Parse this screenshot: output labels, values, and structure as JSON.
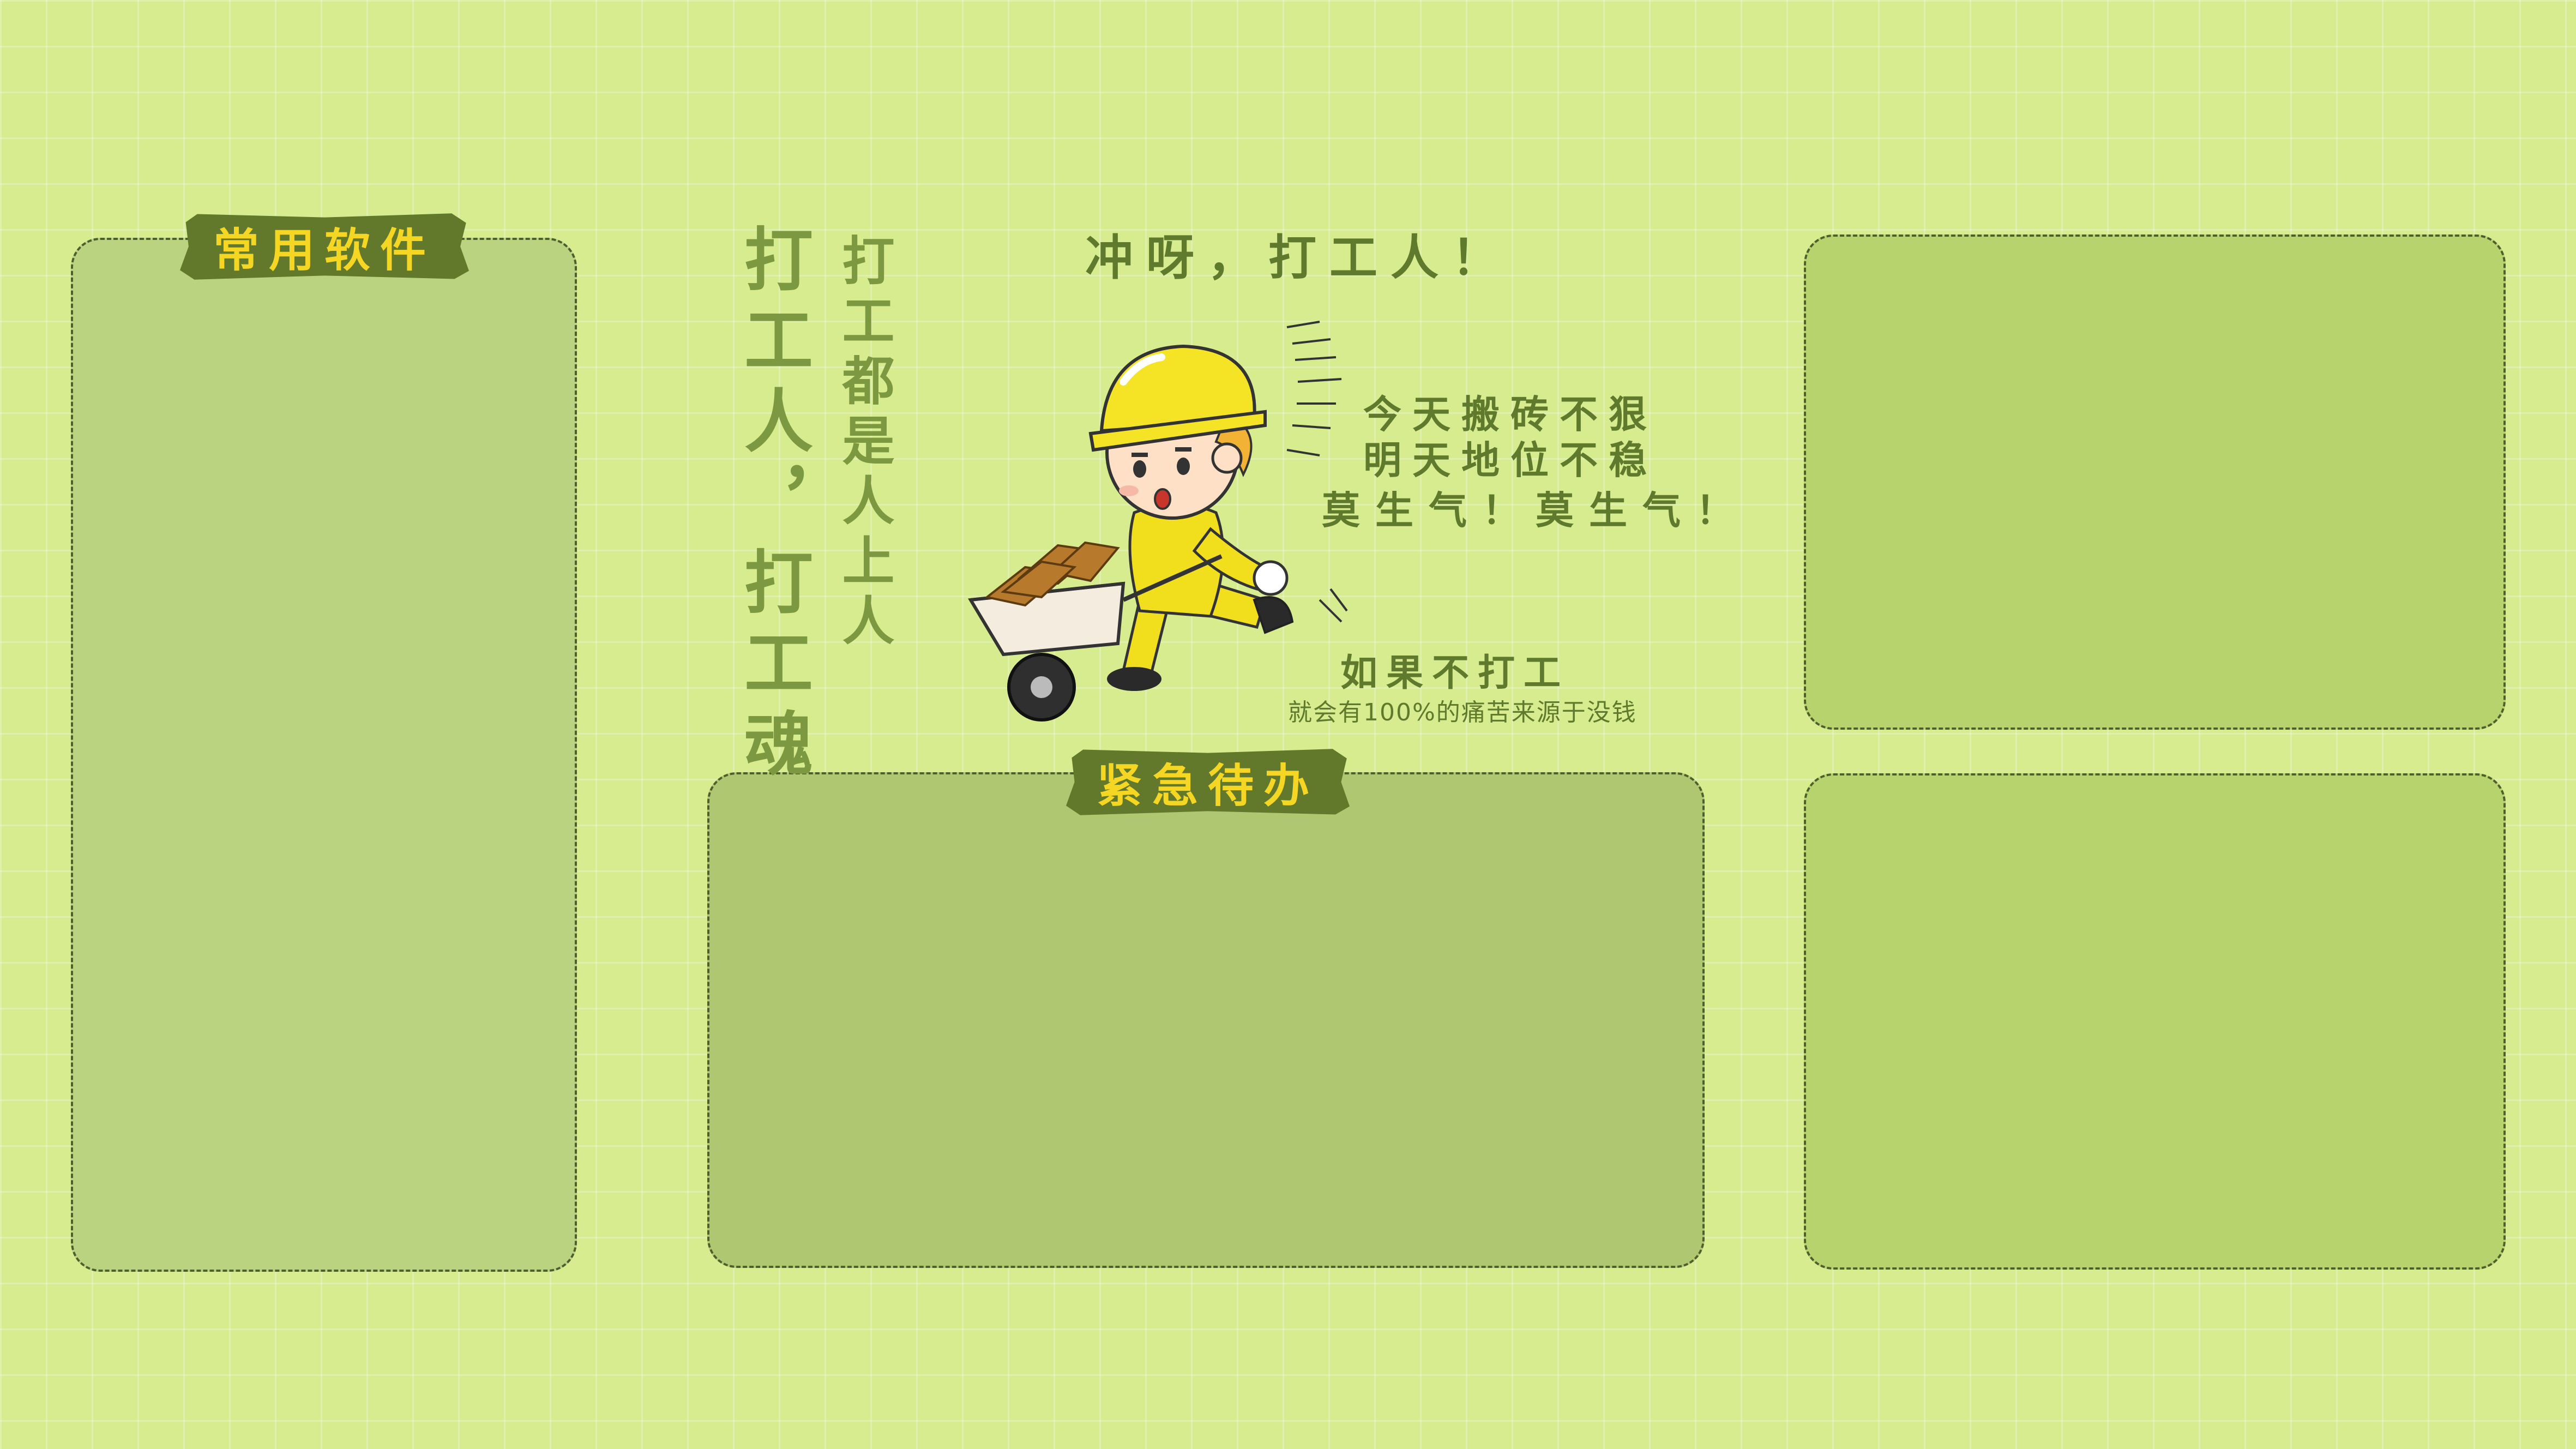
{
  "panels": {
    "apps_label": "常用软件",
    "todo_label": "紧急待办"
  },
  "slogans": {
    "vertical_main": "打工人，打工魂",
    "vertical_sub": "打工都是人上人",
    "cheer": "冲呀，打工人！",
    "poem": [
      "今天搬砖不狠",
      "明天地位不稳",
      "莫生气！莫生气！"
    ],
    "if_not": "如果不打工",
    "if_not_sub": "就会有100%的痛苦来源于没钱"
  },
  "colors": {
    "background": "#d6ec8f",
    "panel": "#b6d36d",
    "tag_bg": "#62792c",
    "tag_text": "#f5d623",
    "text": "#7c9840"
  },
  "illustration": "construction-worker-pushing-wheelbarrow"
}
